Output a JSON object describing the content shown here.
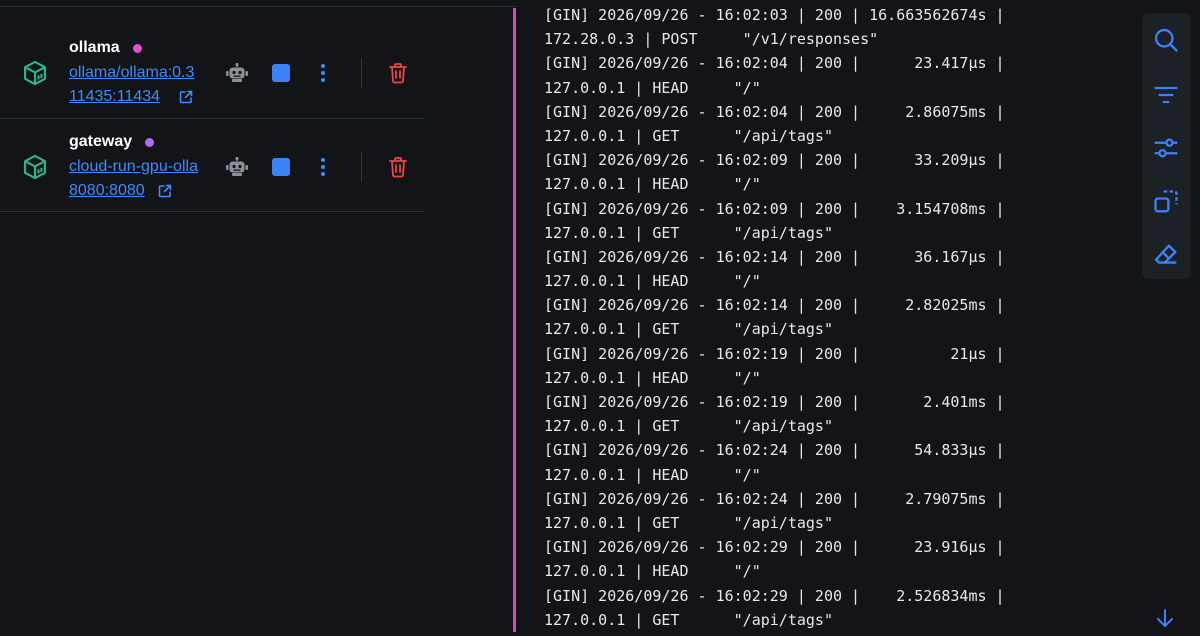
{
  "containers": [
    {
      "name": "ollama",
      "status_color": "#e04fd8",
      "image": "ollama/ollama:0.3",
      "ports": "11435:11434",
      "icon": "container-cube-icon"
    },
    {
      "name": "gateway",
      "status_color": "#b86bf2",
      "image": "cloud-run-gpu-olla",
      "ports": "8080:8080",
      "icon": "container-cube-icon"
    }
  ],
  "row_actions": {
    "bot_icon": "robot-icon",
    "stop_icon": "stop-icon",
    "menu_icon": "kebab-menu-icon",
    "delete_icon": "trash-icon",
    "delete_color": "#ef4444"
  },
  "logs": [
    "[GIN] 2026/09/26 - 16:02:03 | 200 | 16.663562674s |",
    "172.28.0.3 | POST     \"/v1/responses\"",
    "[GIN] 2026/09/26 - 16:02:04 | 200 |      23.417µs |",
    "127.0.0.1 | HEAD     \"/\"",
    "[GIN] 2026/09/26 - 16:02:04 | 200 |     2.86075ms |",
    "127.0.0.1 | GET      \"/api/tags\"",
    "[GIN] 2026/09/26 - 16:02:09 | 200 |      33.209µs |",
    "127.0.0.1 | HEAD     \"/\"",
    "[GIN] 2026/09/26 - 16:02:09 | 200 |    3.154708ms |",
    "127.0.0.1 | GET      \"/api/tags\"",
    "[GIN] 2026/09/26 - 16:02:14 | 200 |      36.167µs |",
    "127.0.0.1 | HEAD     \"/\"",
    "[GIN] 2026/09/26 - 16:02:14 | 200 |     2.82025ms |",
    "127.0.0.1 | GET      \"/api/tags\"",
    "[GIN] 2026/09/26 - 16:02:19 | 200 |          21µs |",
    "127.0.0.1 | HEAD     \"/\"",
    "[GIN] 2026/09/26 - 16:02:19 | 200 |       2.401ms |",
    "127.0.0.1 | GET      \"/api/tags\"",
    "[GIN] 2026/09/26 - 16:02:24 | 200 |      54.833µs |",
    "127.0.0.1 | HEAD     \"/\"",
    "[GIN] 2026/09/26 - 16:02:24 | 200 |     2.79075ms |",
    "127.0.0.1 | GET      \"/api/tags\"",
    "[GIN] 2026/09/26 - 16:02:29 | 200 |      23.916µs |",
    "127.0.0.1 | HEAD     \"/\"",
    "[GIN] 2026/09/26 - 16:02:29 | 200 |    2.526834ms |",
    "127.0.0.1 | GET      \"/api/tags\""
  ],
  "log_accent_color": "#d946c8",
  "toolbar": {
    "tools": [
      "search-icon",
      "filter-icon",
      "sliders-icon",
      "copy-icon",
      "eraser-icon"
    ],
    "accent_color": "#3b82f6"
  },
  "scroll_down_icon": "arrow-down-icon"
}
